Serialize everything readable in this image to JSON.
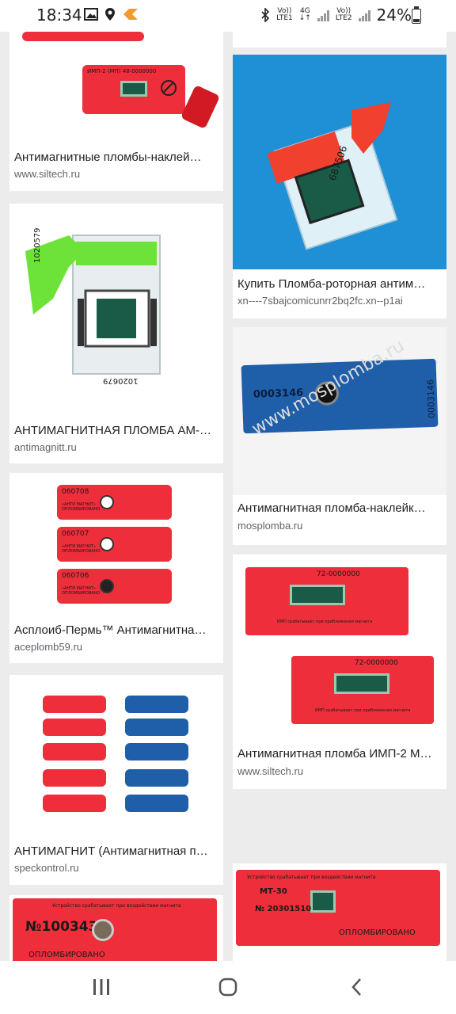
{
  "status": {
    "time": "18:34",
    "battery": "24%",
    "net1_top": "Vo))",
    "net1_bottom": "LTE1",
    "net_mid_top": "4G",
    "net_mid_bottom": "↓↑",
    "net2_top": "Vo))",
    "net2_bottom": "LTE2"
  },
  "results": [
    {
      "title": "Антимагнитные пломбы-наклей…",
      "source": "www.siltech.ru"
    },
    {
      "title": "",
      "source": ""
    },
    {
      "title": "Купить Пломба-роторная антим…",
      "source": "xn----7sbajcomicunrr2bq2fc.xn--p1ai"
    },
    {
      "title": "АНТИМАГНИТНАЯ ПЛОМБА АМ-…",
      "source": "antimagnitt.ru"
    },
    {
      "title": "Антимагнитная пломба-наклейк…",
      "source": "mosplomba.ru"
    },
    {
      "title": "Асплоиб-Пермь™ Антимагнитна…",
      "source": "aceplomb59.ru"
    },
    {
      "title": "Антимагнитная пломба ИМП-2 М…",
      "source": "www.siltech.ru"
    },
    {
      "title": "АНТИМАГНИТ (Антимагнитная п…",
      "source": "speckontrol.ru"
    }
  ],
  "image_text": {
    "seal1_code": "ИМП-2 (МП)  48-0000000",
    "seal_rotor_num": "687506",
    "green_num": "1020579",
    "green_num2": "1020679",
    "blue_num": "0003146",
    "blue_num2": "0003146",
    "watermark": "www.mosplomba.ru",
    "red_num_a": "060708",
    "red_num_b": "060707",
    "red_num_c": "060706",
    "red_label": "«АНТИ МАГНИТ» ОПЛОМБИРОВАНО",
    "imp_num": "72-0000000",
    "imp_text": "ИМП срабатывает при приближении магнита",
    "bottom_left_num": "№1003438",
    "bottom_left_label": "ОПЛОМБИРОВАНО",
    "bottom_left_head": "Устройство срабатывает при воздействии магнита",
    "bottom_right_num": "№ 20301510",
    "bottom_right_label": "ОПЛОМБИРОВАНО",
    "bottom_right_head": "Устройство срабатывает при воздействии магнита",
    "bottom_right_model": "МТ-30"
  },
  "colors": {
    "seal_red": "#ee2e3a",
    "seal_blue": "#1f5ea8",
    "seal_green": "#6de33a",
    "rotor_bg": "#1f8fd6"
  }
}
